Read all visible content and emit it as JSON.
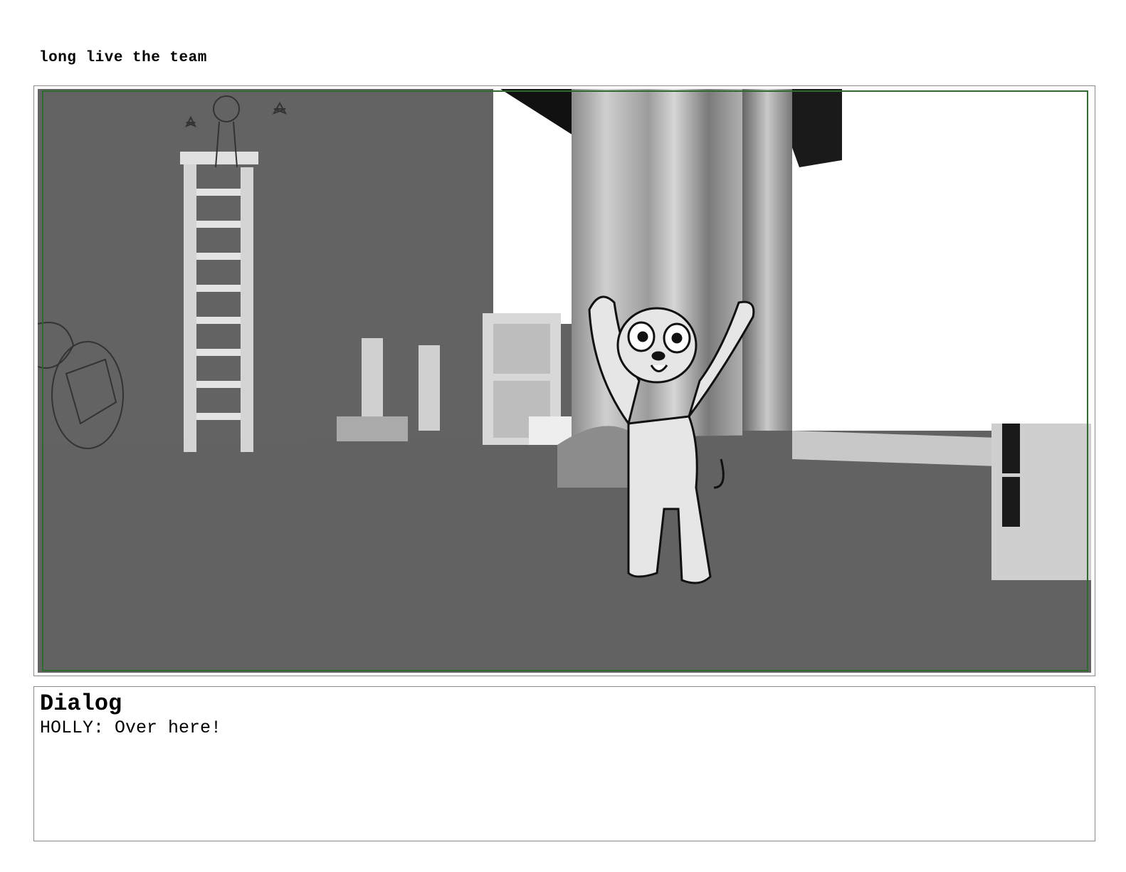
{
  "page": {
    "title": "long live the team"
  },
  "panel": {
    "icon": "storyboard-sketch-image"
  },
  "dialog": {
    "heading": "Dialog",
    "text": "HOLLY: Over here!"
  },
  "colors": {
    "frame_border": "#8a8a8a",
    "safe_frame": "#2e6b2e",
    "scene_floor": "#626262"
  }
}
